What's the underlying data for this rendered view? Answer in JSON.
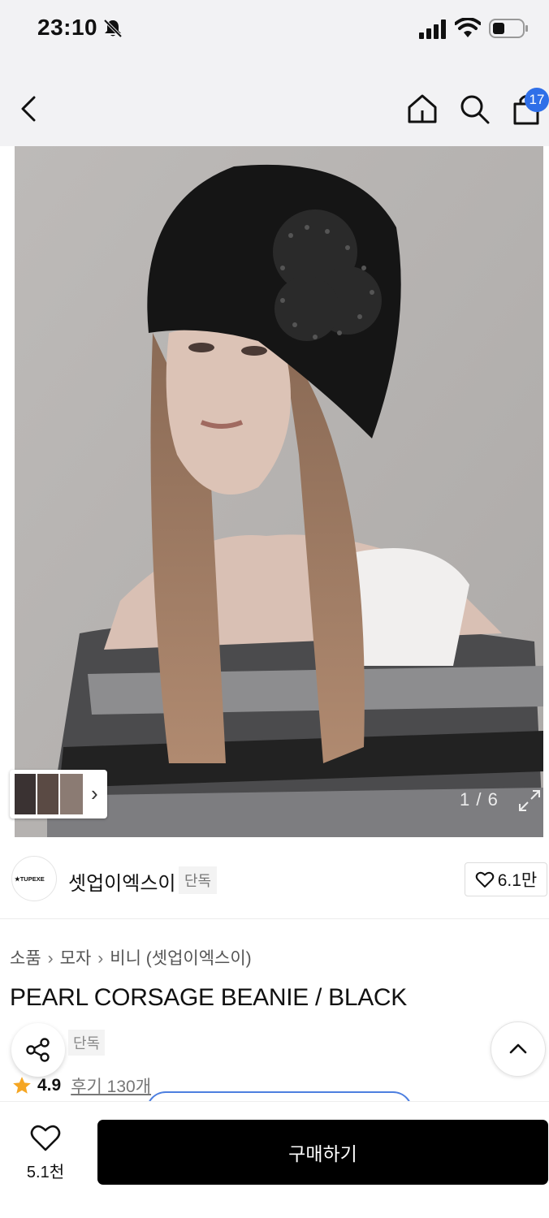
{
  "status_bar": {
    "time": "23:10"
  },
  "nav": {
    "cart_count": "17"
  },
  "gallery": {
    "counter": "1 / 6"
  },
  "brand": {
    "name": "셋업이엑스이",
    "badge": "단독",
    "logo_text": "★TUPEXE",
    "like_count": "6.1만"
  },
  "breadcrumb": [
    "소품",
    "모자",
    "비니 (셋업이엑스이)"
  ],
  "product": {
    "title": "PEARL CORSAGE BEANIE / BLACK",
    "exclusive_tag": "단독",
    "rating": "4.9",
    "review_link": "후기 130개"
  },
  "bottom_bar": {
    "wish_count": "5.1천",
    "buy_label": "구매하기"
  },
  "colors": {
    "accent_blue": "#2f6fe8",
    "star": "#f5a623",
    "buy_button": "#000000"
  },
  "icons": [
    "bell-slash-icon",
    "signal-icon",
    "wifi-icon",
    "battery-icon",
    "back-icon",
    "home-icon",
    "search-icon",
    "cart-icon",
    "expand-icon",
    "heart-icon",
    "share-icon",
    "chevron-up-icon",
    "star-icon"
  ]
}
